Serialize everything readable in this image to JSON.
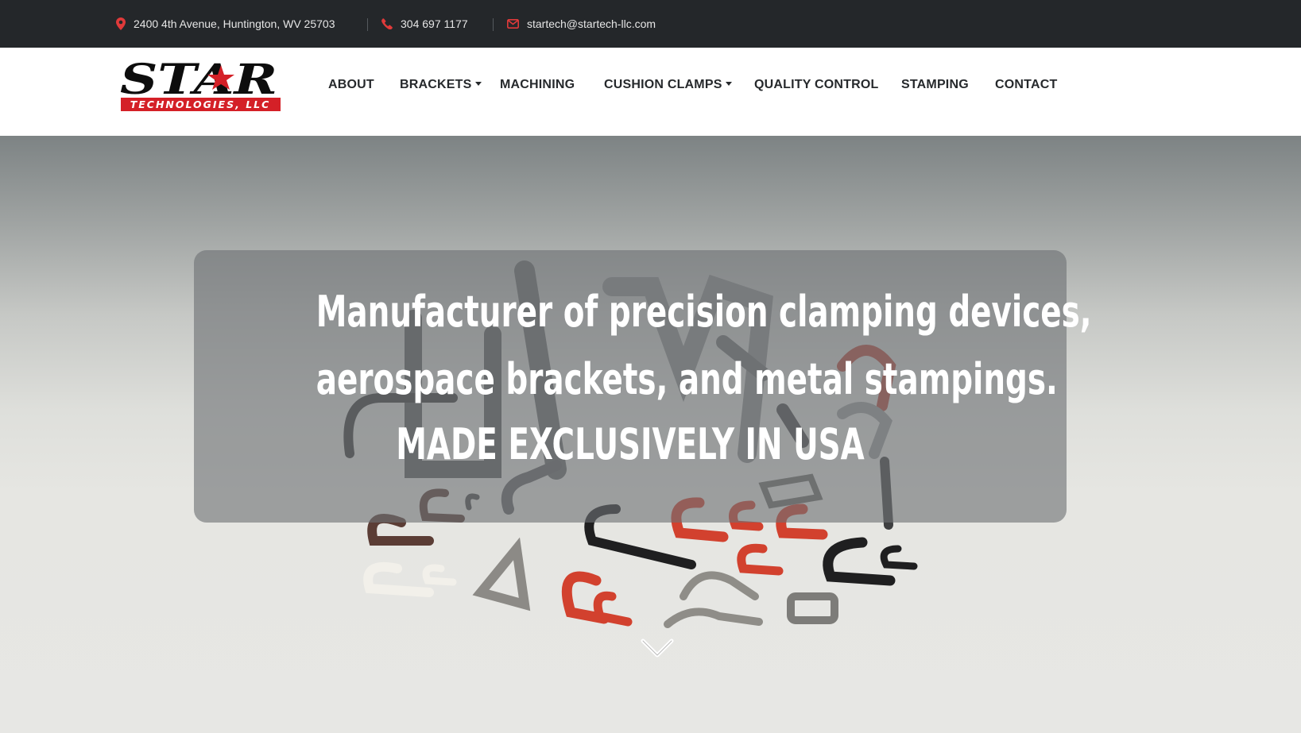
{
  "topbar": {
    "address": "2400 4th Avenue, Huntington, WV 25703",
    "phone": "304 697 1177",
    "email": "startech@startech-llc.com",
    "icons": {
      "address": "map-marker-icon",
      "phone": "phone-icon",
      "email": "envelope-icon"
    },
    "accent_color": "#e03a3a"
  },
  "logo": {
    "wordmark": "STAR",
    "subtitle": "TECHNOLOGIES, LLC",
    "brand_red": "#d42027"
  },
  "nav": {
    "items": [
      {
        "label": "ABOUT",
        "dropdown": false
      },
      {
        "label": "BRACKETS",
        "dropdown": true
      },
      {
        "label": "MACHINING",
        "dropdown": false
      },
      {
        "label": "CUSHION CLAMPS",
        "dropdown": true
      },
      {
        "label": "QUALITY CONTROL",
        "dropdown": false
      },
      {
        "label": "STAMPING",
        "dropdown": false
      },
      {
        "label": "CONTACT",
        "dropdown": false
      }
    ]
  },
  "hero": {
    "line1": "Manufacturer of precision clamping devices,",
    "line2": "aerospace brackets, and metal stampings.",
    "line3": "MADE EXCLUSIVELY IN USA",
    "scroll_icon": "chevron-down-icon"
  }
}
